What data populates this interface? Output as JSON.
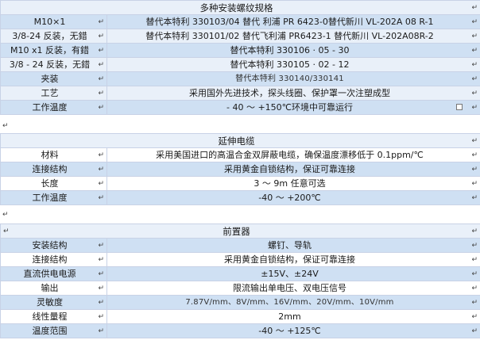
{
  "return_mark": "↵",
  "section1": {
    "title": "多种安装螺纹规格",
    "rows": [
      {
        "label": "M10×1",
        "value": "替代本特利  330103/04 替代   利浦  PR 6423-0替代新川  VL-202A 08 R-1"
      },
      {
        "label": "3/8-24 反装，无錯",
        "value": "替代本特利  330101/02  替代飞利浦  PR6423-1  替代新川  VL-202A08R-2"
      },
      {
        "label": "M10 x1 反装，有錯",
        "value": "替代本特利  330106  · 05 - 30"
      },
      {
        "label": "3/8 - 24 反装，无錯",
        "value": "替代本特利  330105  · 02 - 12"
      },
      {
        "label": "夹装",
        "value": "替代本特利    330140/330141"
      },
      {
        "label": "工艺",
        "value": "采用国外先进技术，探头线圈、保护罩一次注塑成型"
      },
      {
        "label": "工作温度",
        "value": "- 40 ～ +150℃环境中可靠运行"
      }
    ]
  },
  "section2": {
    "title": "延伸电缆",
    "rows": [
      {
        "label": "材料",
        "value": "采用美国进口的高温合金双屏蔽电缆，确保温度漂移低于  0.1ppm/℃"
      },
      {
        "label": "连接结构",
        "value": "采用黄金自锁结构，保证可靠连接"
      },
      {
        "label": "长度",
        "value": "3 ～ 9m 任意可选"
      },
      {
        "label": "工作温度",
        "value": "-40 ～ +200℃"
      }
    ]
  },
  "section3": {
    "title": "前置器",
    "rows": [
      {
        "label": "安装结构",
        "value": "螺钉、导轨"
      },
      {
        "label": "连接结构",
        "value": "采用黄金自锁结构，保证可靠连接"
      },
      {
        "label": "直流供电电源",
        "value": "±15V、±24V"
      },
      {
        "label": "输出",
        "value": "限流输出单电压、双电压信号"
      },
      {
        "label": "灵敏度",
        "value": "7.87V/mm、8V/mm、16V/mm、20V/mm、10V/mm"
      },
      {
        "label": "线性量程",
        "value": "2mm"
      },
      {
        "label": "温度范围",
        "value": "-40 ～ +125℃"
      }
    ]
  }
}
